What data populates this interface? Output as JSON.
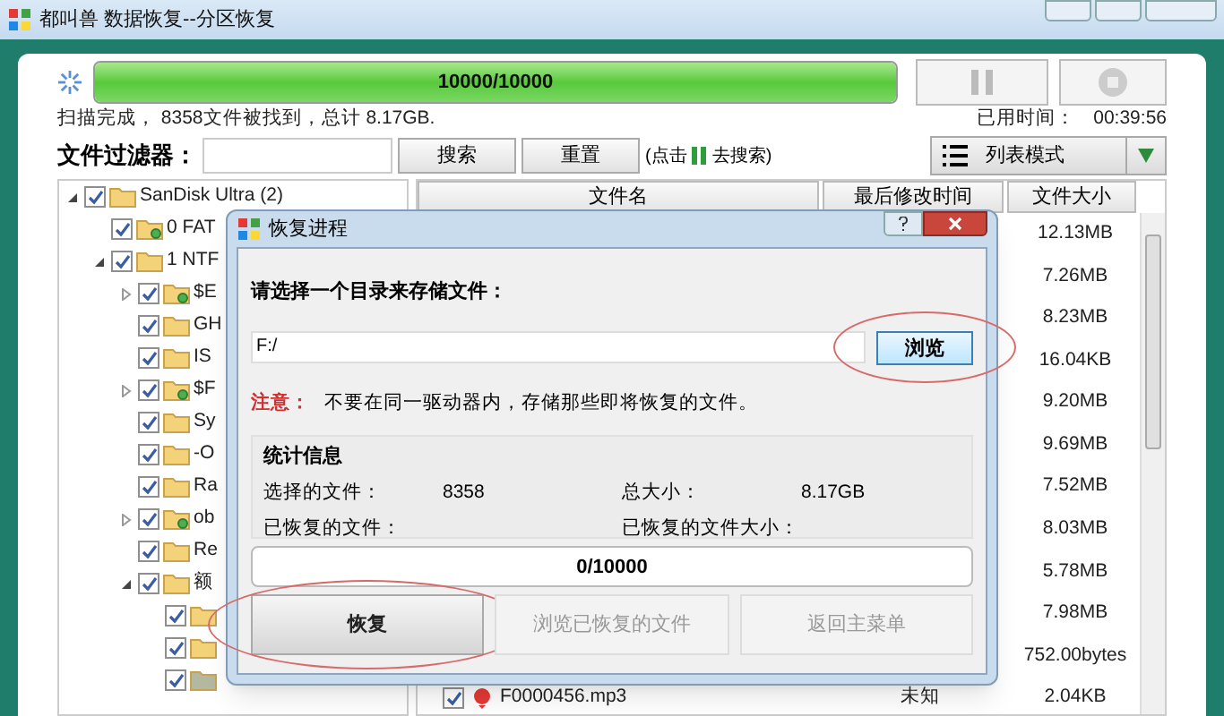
{
  "window": {
    "title": "都叫兽 数据恢复--分区恢复"
  },
  "scan": {
    "progress_text": "10000/10000",
    "level": 1,
    "status": "扫描完成， 8358文件被找到，总计 8.17GB.",
    "elapsed_label": "已用时间：",
    "elapsed": "00:39:56"
  },
  "filter": {
    "label": "文件过滤器：",
    "search_button": "搜索",
    "reset_button": "重置",
    "hint_before": "(点击",
    "hint_after": "去搜索)",
    "view_mode": "列表模式"
  },
  "tree": [
    {
      "name": "SanDisk Ultra (2)",
      "checked": true,
      "expanded": true,
      "children": [
        {
          "name": "0 FAT",
          "checked": true,
          "kind": "partition"
        },
        {
          "name": "1 NTF",
          "checked": true,
          "expanded": true,
          "children": [
            {
              "name": "$E",
              "checked": true,
              "expanded": false,
              "kind": "partition"
            },
            {
              "name": "GH",
              "checked": true
            },
            {
              "name": "IS",
              "checked": true
            },
            {
              "name": "$F",
              "checked": true,
              "expanded": false,
              "kind": "partition"
            },
            {
              "name": "Sy",
              "checked": true
            },
            {
              "name": "-O",
              "checked": true
            },
            {
              "name": "Ra",
              "checked": true
            },
            {
              "name": "ob",
              "checked": true,
              "expanded": false,
              "kind": "partition"
            },
            {
              "name": "Re",
              "checked": true
            },
            {
              "name": "额",
              "checked": true,
              "expanded": true,
              "children": [
                {
                  "checked": true
                },
                {
                  "checked": true
                },
                {
                  "checked": true,
                  "kind": "grey"
                }
              ]
            }
          ]
        }
      ]
    }
  ],
  "table": {
    "columns": [
      "文件名",
      "最后修改时间",
      "文件大小"
    ],
    "rows": [
      {
        "size": "12.13MB"
      },
      {
        "size": "7.26MB"
      },
      {
        "size": "8.23MB"
      },
      {
        "size": "16.04KB"
      },
      {
        "size": "9.20MB"
      },
      {
        "size": "9.69MB"
      },
      {
        "size": "7.52MB"
      },
      {
        "size": "8.03MB"
      },
      {
        "size": "5.78MB"
      },
      {
        "size": "7.98MB"
      },
      {
        "size": "752.00bytes"
      },
      {
        "name": "F0000456.mp3",
        "modified": "未知",
        "size": "2.04KB",
        "checked": true
      }
    ]
  },
  "dialog": {
    "title": "恢复进程",
    "prompt": "请选择一个目录来存储文件：",
    "path": "F:/",
    "browse_button": {
      "label": "浏览",
      "highlighted": true
    },
    "note_label": "注意：",
    "note": "不要在同一驱动器内，存储那些即将恢复的文件。",
    "stats": {
      "title": "统计信息",
      "items": [
        {
          "label": "选择的文件：",
          "value": "8358"
        },
        {
          "label": "总大小：",
          "value": "8.17GB"
        },
        {
          "label": "已恢复的文件："
        },
        {
          "label": "已恢复的文件大小："
        }
      ]
    },
    "progress_text": "0/10000",
    "level": 0,
    "buttons": [
      {
        "label": "恢复",
        "disabled": false,
        "highlighted": true
      },
      {
        "label": "浏览已恢复的文件",
        "disabled": true,
        "highlighted": false
      },
      {
        "label": "返回主菜单",
        "disabled": true,
        "highlighted": false
      }
    ]
  }
}
